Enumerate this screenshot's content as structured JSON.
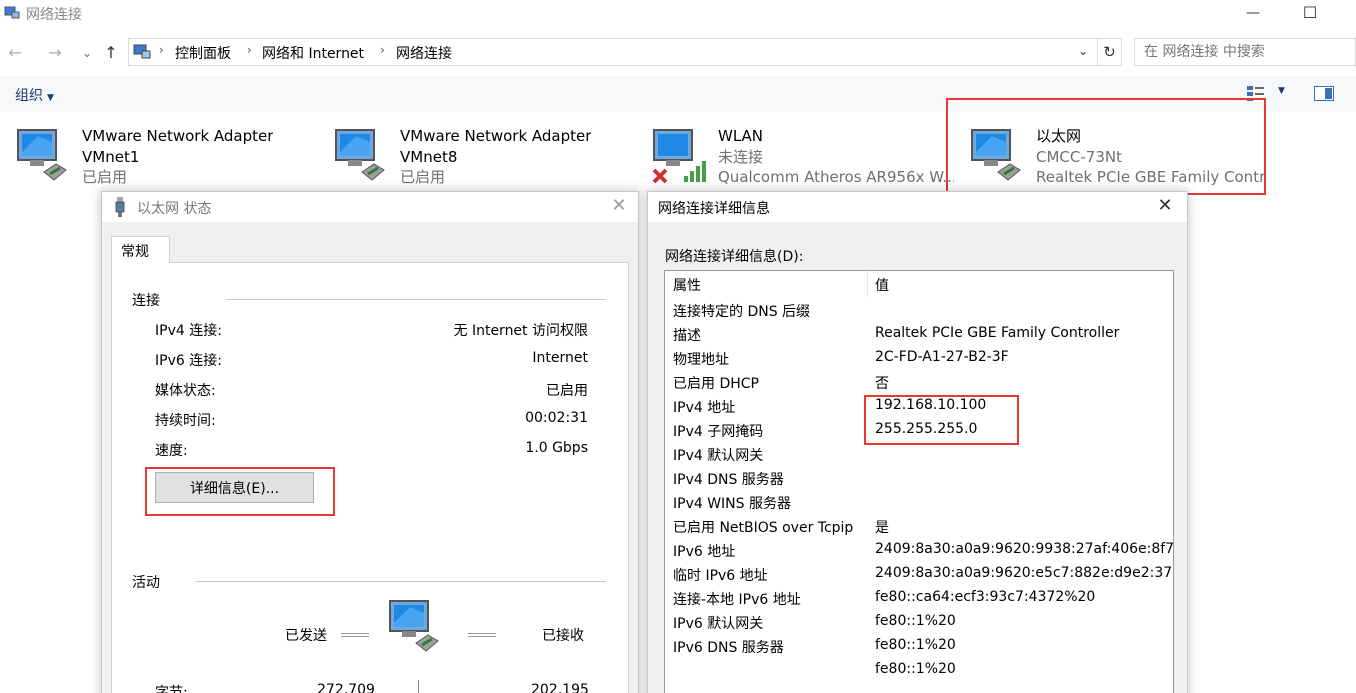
{
  "window": {
    "title": "网络连接",
    "minimize": "—",
    "maximize": "☐"
  },
  "nav": {
    "back": "←",
    "forward": "→",
    "recent": "⌄",
    "up": "↑"
  },
  "breadcrumb": [
    "控制面板",
    "网络和 Internet",
    "网络连接"
  ],
  "search": {
    "placeholder": "在 网络连接 中搜索"
  },
  "toolbar": {
    "organize": "组织"
  },
  "adapters": [
    {
      "name": "VMware Network Adapter",
      "sub": "VMnet1",
      "status": "已启用",
      "icon": "network-adapter-icon"
    },
    {
      "name": "VMware Network Adapter",
      "sub": "VMnet8",
      "status": "已启用",
      "icon": "network-adapter-icon"
    },
    {
      "name": "WLAN",
      "sub": "未连接",
      "status": "Qualcomm Atheros AR956x W...",
      "icon": "wlan-disconnected-icon"
    },
    {
      "name": "以太网",
      "sub": "CMCC-73Nt",
      "status": "Realtek PCIe GBE Family Contr...",
      "icon": "ethernet-adapter-icon"
    }
  ],
  "status_dialog": {
    "title": "以太网 状态",
    "tab": "常规",
    "connection_group": "连接",
    "rows": [
      {
        "label": "IPv4 连接:",
        "value": "无 Internet 访问权限"
      },
      {
        "label": "IPv6 连接:",
        "value": "Internet"
      },
      {
        "label": "媒体状态:",
        "value": "已启用"
      },
      {
        "label": "持续时间:",
        "value": "00:02:31"
      },
      {
        "label": "速度:",
        "value": "1.0 Gbps"
      }
    ],
    "details_button": "详细信息(E)...",
    "activity_group": "活动",
    "sent_label": "已发送",
    "received_label": "已接收",
    "bytes_label": "字节:",
    "bytes_sent": "272,709",
    "bytes_received": "202,195"
  },
  "detail_dialog": {
    "title": "网络连接详细信息",
    "caption": "网络连接详细信息(D):",
    "col_property": "属性",
    "col_value": "值",
    "rows": [
      {
        "prop": "连接特定的 DNS 后缀",
        "val": ""
      },
      {
        "prop": "描述",
        "val": "Realtek PCIe GBE Family Controller"
      },
      {
        "prop": "物理地址",
        "val": "2C-FD-A1-27-B2-3F"
      },
      {
        "prop": "已启用 DHCP",
        "val": "否"
      },
      {
        "prop": "IPv4 地址",
        "val": "192.168.10.100"
      },
      {
        "prop": "IPv4 子网掩码",
        "val": "255.255.255.0"
      },
      {
        "prop": "IPv4 默认网关",
        "val": ""
      },
      {
        "prop": "IPv4 DNS 服务器",
        "val": ""
      },
      {
        "prop": "IPv4 WINS 服务器",
        "val": ""
      },
      {
        "prop": "已启用 NetBIOS over Tcpip",
        "val": "是"
      },
      {
        "prop": "IPv6 地址",
        "val": "2409:8a30:a0a9:9620:9938:27af:406e:8f7..."
      },
      {
        "prop": "临时 IPv6 地址",
        "val": "2409:8a30:a0a9:9620:e5c7:882e:d9e2:37..."
      },
      {
        "prop": "连接-本地 IPv6 地址",
        "val": "fe80::ca64:ecf3:93c7:4372%20"
      },
      {
        "prop": "IPv6 默认网关",
        "val": "fe80::1%20"
      },
      {
        "prop": "IPv6 DNS 服务器",
        "val": "fe80::1%20"
      },
      {
        "prop": "",
        "val": "fe80::1%20"
      }
    ]
  },
  "colors": {
    "highlight": "#e53935",
    "accent": "#1a3d6e"
  }
}
